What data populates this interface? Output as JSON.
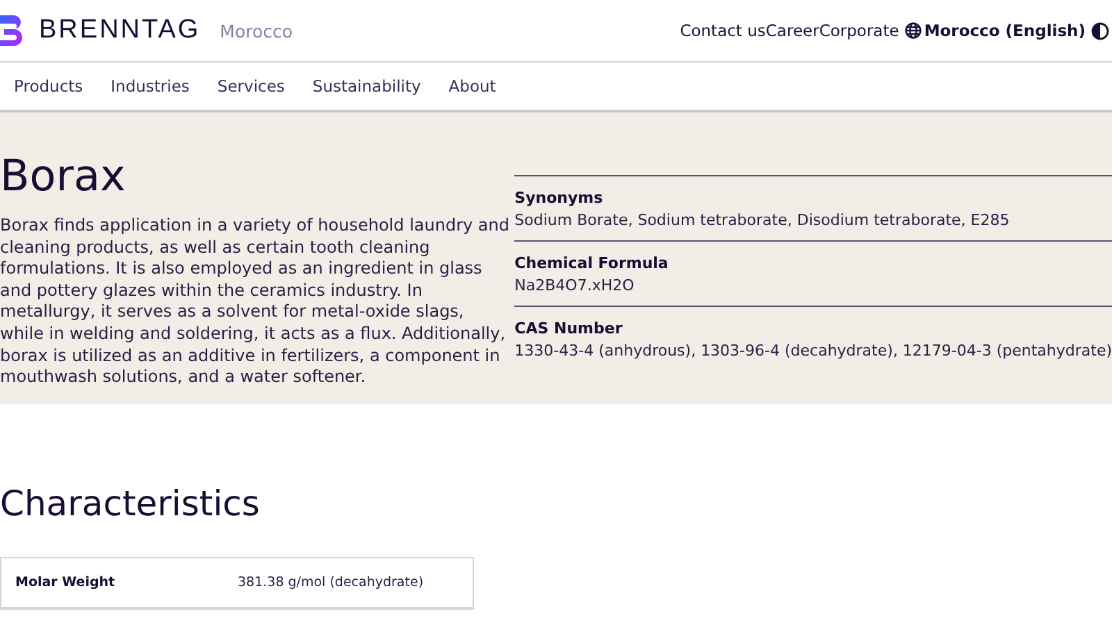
{
  "header": {
    "brand": "BRENNTAG",
    "region": "Morocco",
    "links": [
      "Contact us",
      "Career",
      "Corporate"
    ],
    "language": "Morocco (English)"
  },
  "nav": {
    "items": [
      "Products",
      "Industries",
      "Services",
      "Sustainability",
      "About"
    ]
  },
  "hero": {
    "title": "Borax",
    "description": "Borax finds application in a variety of household laundry and cleaning products, as well as certain tooth cleaning formulations. It is also employed as an ingredient in glass and pottery glazes within the ceramics industry. In metallurgy, it serves as a solvent for metal-oxide slags, while in welding and soldering, it acts as a flux. Additionally, borax is utilized as an additive in fertilizers, a component in mouthwash solutions, and a water softener.",
    "facts": [
      {
        "label": "Synonyms",
        "value": "Sodium Borate, Sodium tetraborate, Disodium tetraborate, E285"
      },
      {
        "label": "Chemical Formula",
        "value": "Na2B4O7.xH2O"
      },
      {
        "label": "CAS Number",
        "value": "1330-43-4 (anhydrous), 1303-96-4 (decahydrate), 12179-04-3 (pentahydrate)"
      }
    ]
  },
  "characteristics": {
    "title": "Characteristics",
    "rows": [
      {
        "label": "Molar Weight",
        "value": "381.38 g/mol (decahydrate)"
      }
    ]
  }
}
